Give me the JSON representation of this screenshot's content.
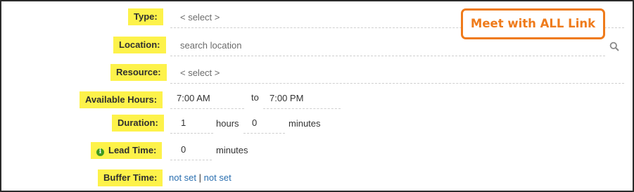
{
  "callout": {
    "text": "Meet with ALL Link",
    "color": "#ef7b1b"
  },
  "form": {
    "type": {
      "label": "Type:",
      "value": "< select >"
    },
    "location": {
      "label": "Location:",
      "placeholder": "search location"
    },
    "resource": {
      "label": "Resource:",
      "value": "< select >"
    },
    "available_hours": {
      "label": "Available Hours:",
      "start": "7:00 AM",
      "to": "to",
      "end": "7:00 PM"
    },
    "duration": {
      "label": "Duration:",
      "hours_value": "1",
      "hours_unit": "hours",
      "minutes_value": "0",
      "minutes_unit": "minutes"
    },
    "lead_time": {
      "label": "Lead Time:",
      "icon": "info-icon",
      "value": "0",
      "unit": "minutes"
    },
    "buffer_time": {
      "label": "Buffer Time:",
      "before": "not set",
      "separator": "|",
      "after": "not set"
    }
  },
  "colors": {
    "label_highlight": "#fdf24a",
    "link": "#2a6fb0",
    "info_icon": "#3f9a1f"
  }
}
